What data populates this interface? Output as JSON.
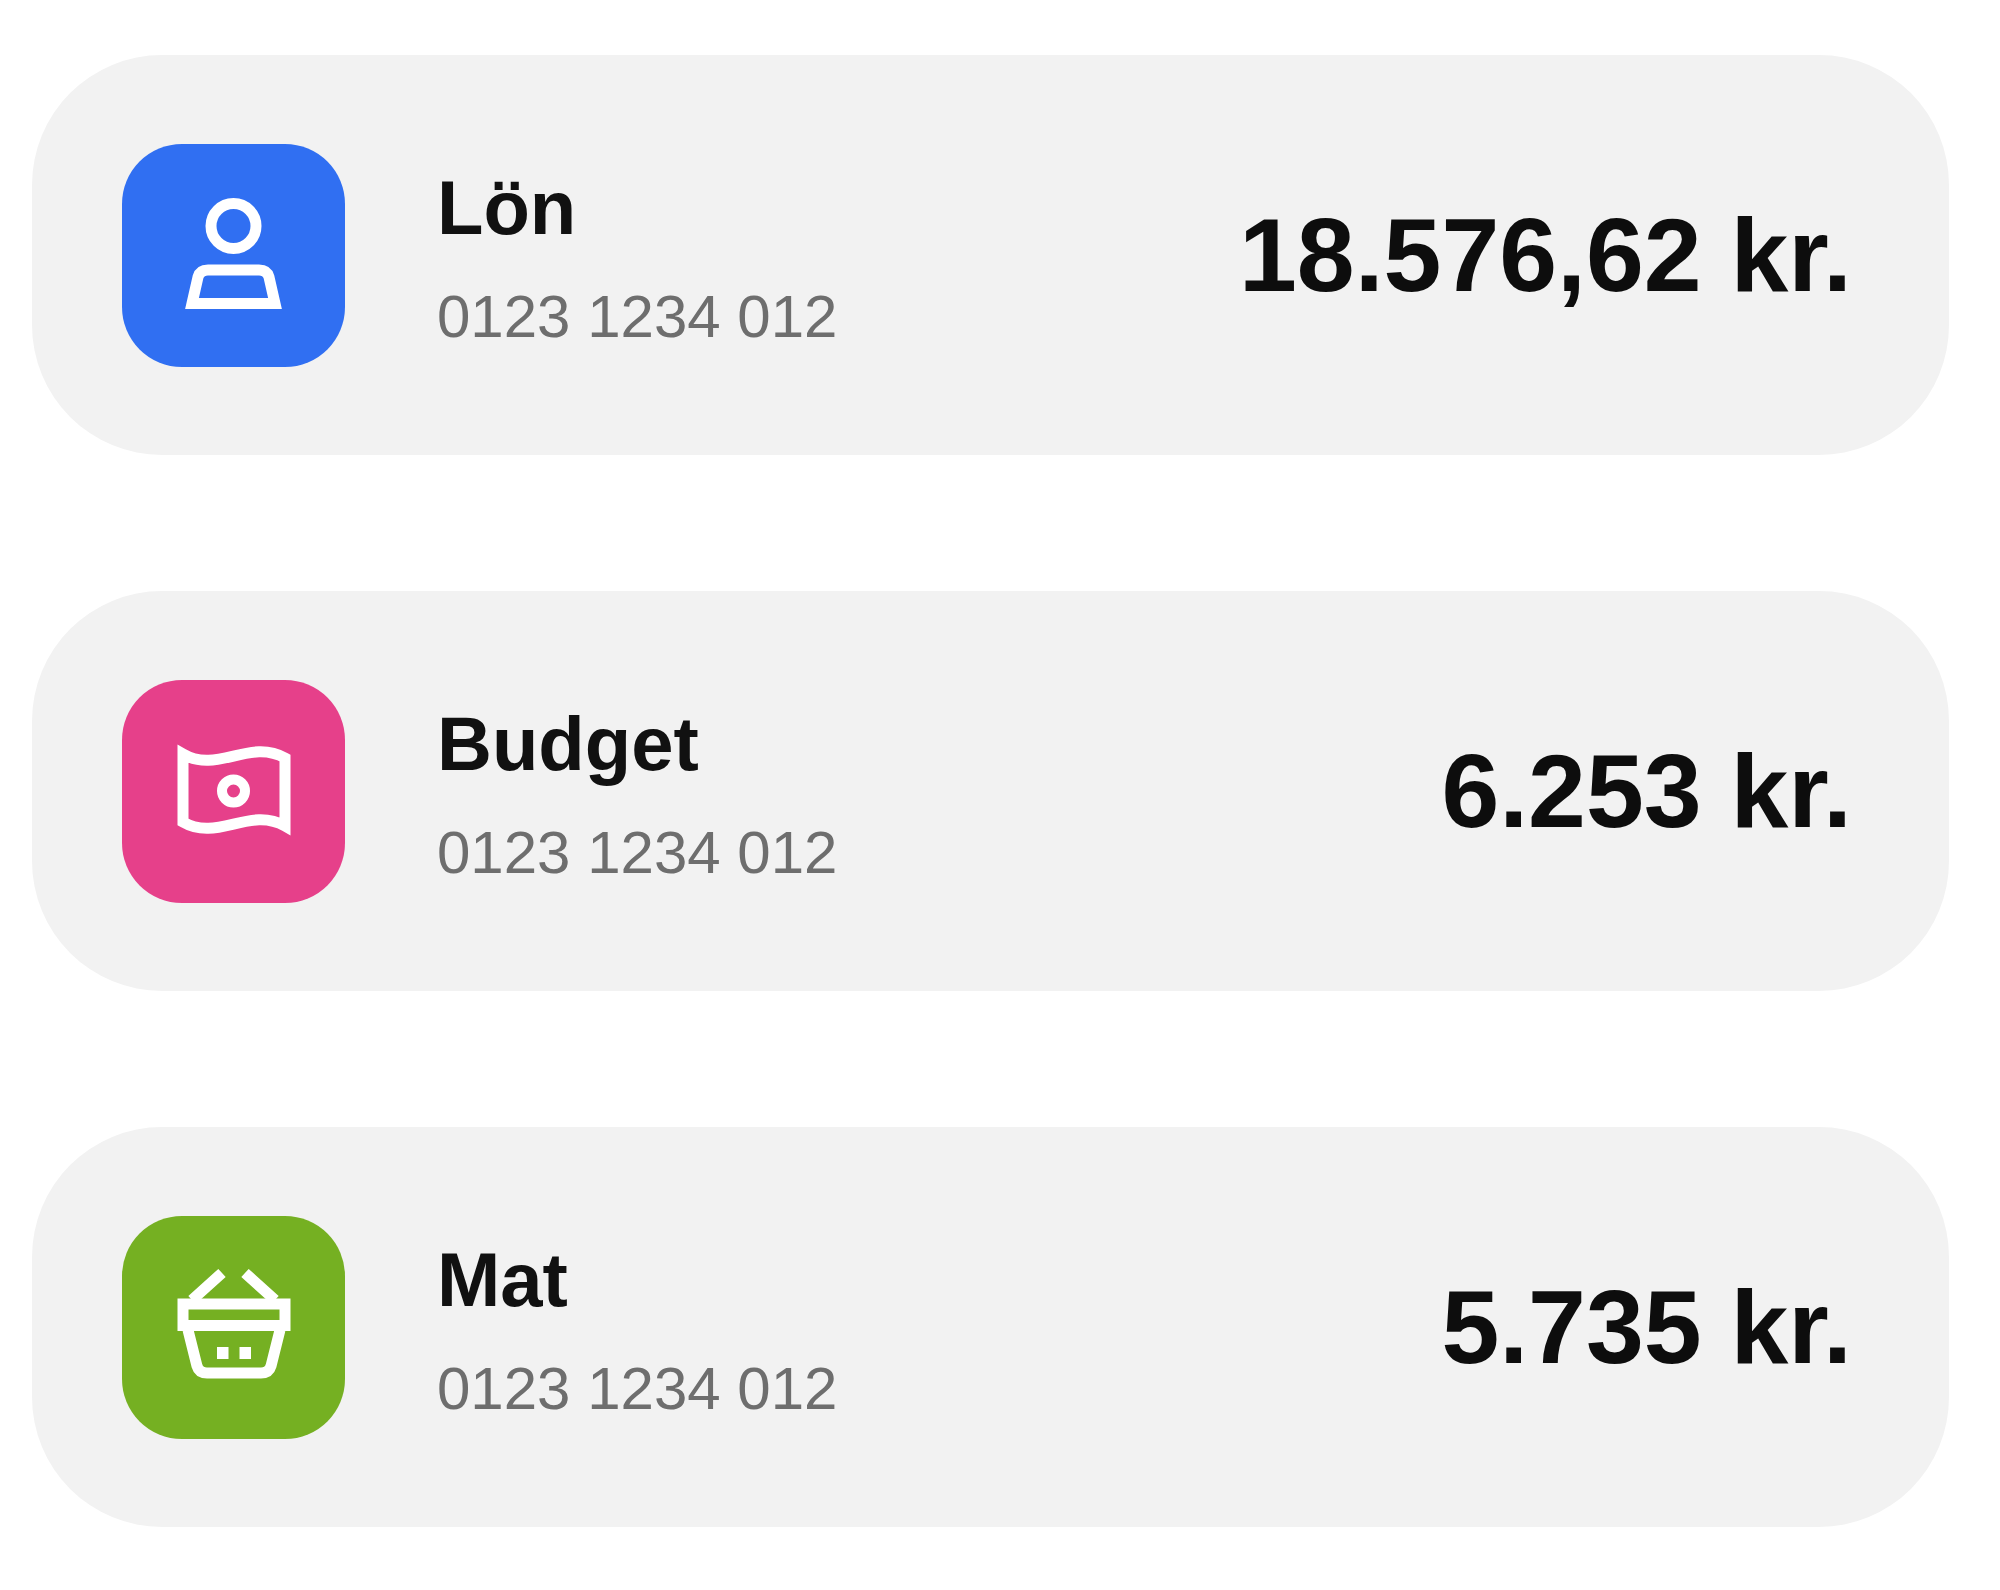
{
  "accounts": [
    {
      "name": "Lön",
      "number": "0123 1234 012",
      "amount": "18.576,62 kr.",
      "color": "#306ff2"
    },
    {
      "name": "Budget",
      "number": "0123 1234 012",
      "amount": "6.253 kr.",
      "color": "#e6408a"
    },
    {
      "name": "Mat",
      "number": "0123 1234 012",
      "amount": "5.735 kr.",
      "color": "#75b022"
    }
  ]
}
